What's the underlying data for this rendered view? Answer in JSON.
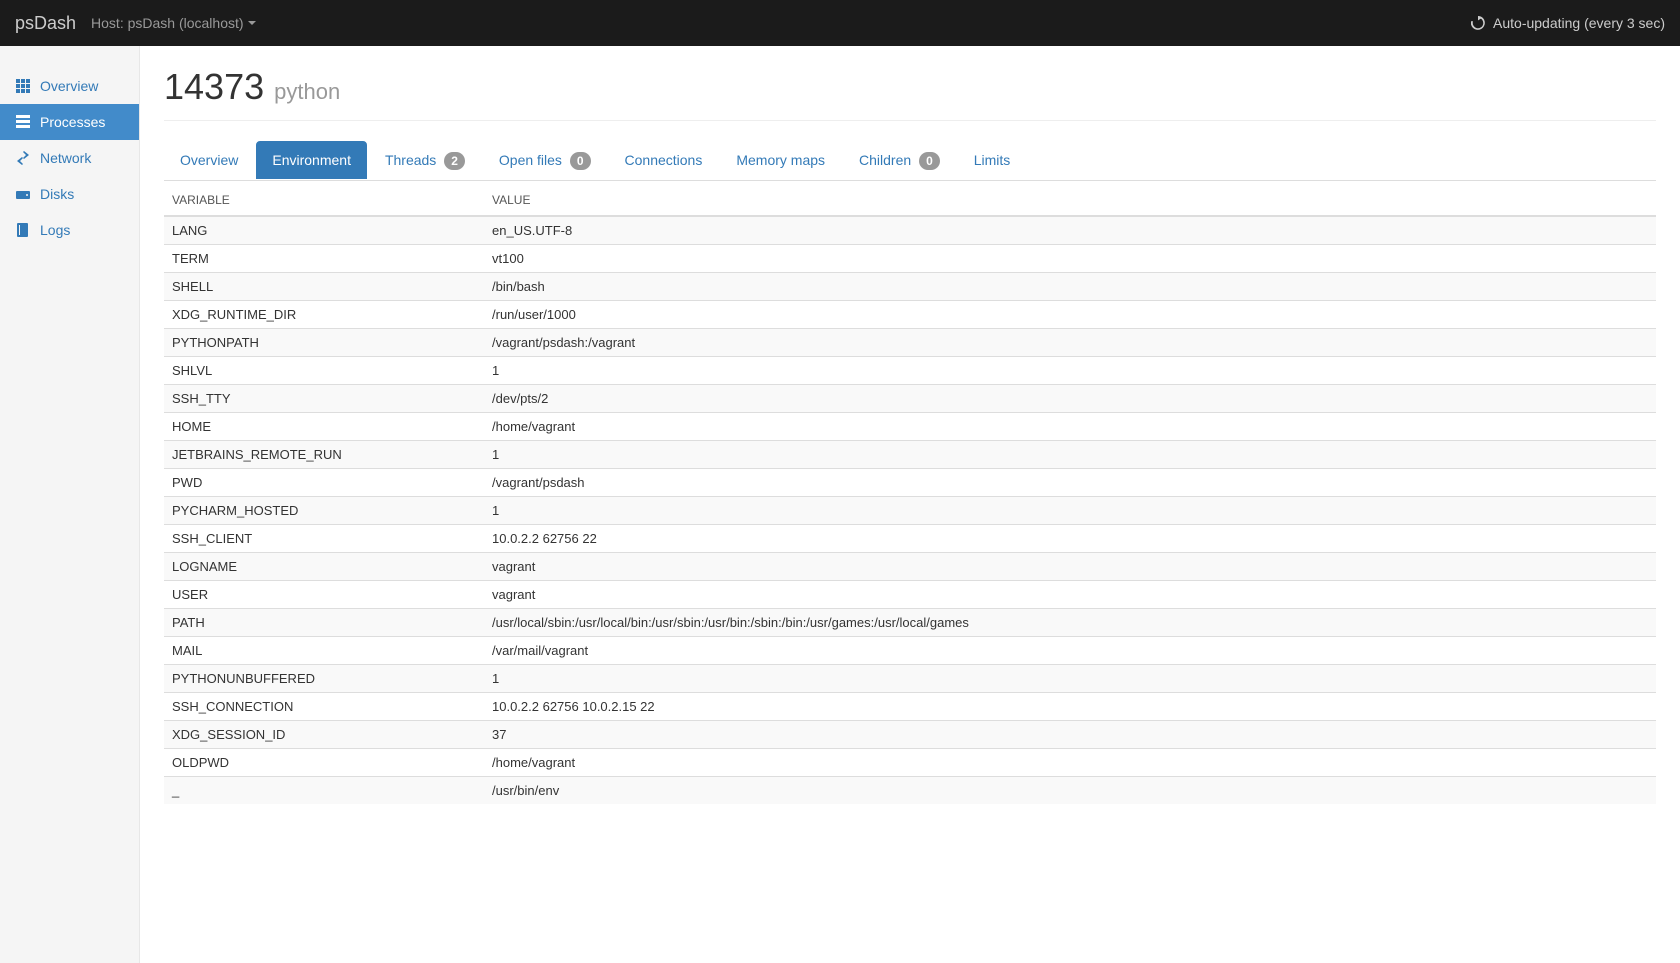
{
  "navbar": {
    "brand": "psDash",
    "host_label": "Host: psDash (localhost)",
    "auto_update": "Auto-updating (every 3 sec)"
  },
  "sidebar": {
    "items": [
      {
        "label": "Overview",
        "icon": "grid",
        "active": false
      },
      {
        "label": "Processes",
        "icon": "tasks",
        "active": true
      },
      {
        "label": "Network",
        "icon": "transfer",
        "active": false
      },
      {
        "label": "Disks",
        "icon": "hdd",
        "active": false
      },
      {
        "label": "Logs",
        "icon": "book",
        "active": false
      }
    ]
  },
  "header": {
    "pid": "14373",
    "name": "python"
  },
  "tabs": [
    {
      "label": "Overview",
      "badge": null,
      "active": false
    },
    {
      "label": "Environment",
      "badge": null,
      "active": true
    },
    {
      "label": "Threads",
      "badge": "2",
      "active": false
    },
    {
      "label": "Open files",
      "badge": "0",
      "active": false
    },
    {
      "label": "Connections",
      "badge": null,
      "active": false
    },
    {
      "label": "Memory maps",
      "badge": null,
      "active": false
    },
    {
      "label": "Children",
      "badge": "0",
      "active": false
    },
    {
      "label": "Limits",
      "badge": null,
      "active": false
    }
  ],
  "table": {
    "headers": [
      "VARIABLE",
      "VALUE"
    ],
    "rows": [
      {
        "variable": "LANG",
        "value": "en_US.UTF-8"
      },
      {
        "variable": "TERM",
        "value": "vt100"
      },
      {
        "variable": "SHELL",
        "value": "/bin/bash"
      },
      {
        "variable": "XDG_RUNTIME_DIR",
        "value": "/run/user/1000"
      },
      {
        "variable": "PYTHONPATH",
        "value": "/vagrant/psdash:/vagrant"
      },
      {
        "variable": "SHLVL",
        "value": "1"
      },
      {
        "variable": "SSH_TTY",
        "value": "/dev/pts/2"
      },
      {
        "variable": "HOME",
        "value": "/home/vagrant"
      },
      {
        "variable": "JETBRAINS_REMOTE_RUN",
        "value": "1"
      },
      {
        "variable": "PWD",
        "value": "/vagrant/psdash"
      },
      {
        "variable": "PYCHARM_HOSTED",
        "value": "1"
      },
      {
        "variable": "SSH_CLIENT",
        "value": "10.0.2.2 62756 22"
      },
      {
        "variable": "LOGNAME",
        "value": "vagrant"
      },
      {
        "variable": "USER",
        "value": "vagrant"
      },
      {
        "variable": "PATH",
        "value": "/usr/local/sbin:/usr/local/bin:/usr/sbin:/usr/bin:/sbin:/bin:/usr/games:/usr/local/games"
      },
      {
        "variable": "MAIL",
        "value": "/var/mail/vagrant"
      },
      {
        "variable": "PYTHONUNBUFFERED",
        "value": "1"
      },
      {
        "variable": "SSH_CONNECTION",
        "value": "10.0.2.2 62756 10.0.2.15 22"
      },
      {
        "variable": "XDG_SESSION_ID",
        "value": "37"
      },
      {
        "variable": "OLDPWD",
        "value": "/home/vagrant"
      },
      {
        "variable": "_",
        "value": "/usr/bin/env"
      }
    ]
  }
}
